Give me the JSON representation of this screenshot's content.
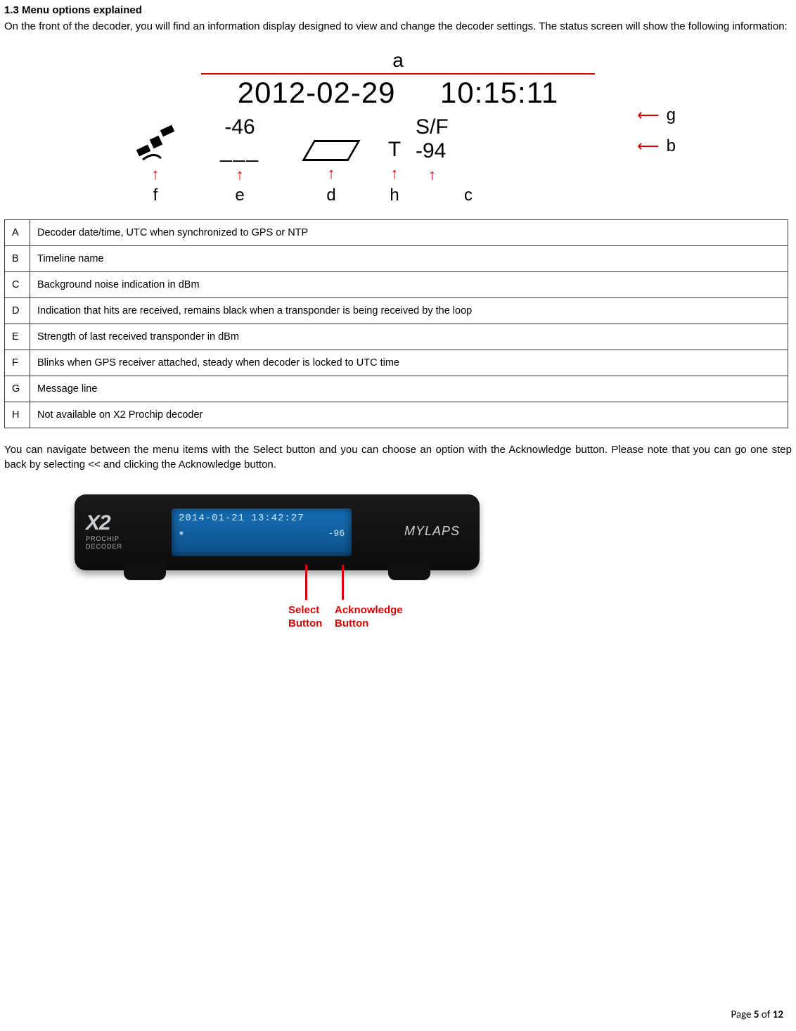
{
  "section": {
    "title": "1.3 Menu options explained",
    "intro": "On the front of the decoder, you will find an information display designed to view and change the decoder settings. The status screen will show the following information:",
    "nav_text": "You can navigate between the menu items with the Select button and you can choose an option with the Acknowledge button. Please note that you can go one step back by selecting << and clicking the Acknowledge button."
  },
  "figure1": {
    "label_a": "a",
    "date": "2012-02-29",
    "time": "10:15:11",
    "strength_e": "-46",
    "dash": "___",
    "h_letter": "T",
    "sf_label": "S/F",
    "noise_c": "-94",
    "label_g": "g",
    "label_b": "b",
    "label_f": "f",
    "label_e": "e",
    "label_d": "d",
    "label_h": "h",
    "label_c": "c"
  },
  "legend": [
    {
      "k": "A",
      "v": "Decoder date/time, UTC when synchronized to GPS or NTP"
    },
    {
      "k": "B",
      "v": "Timeline name"
    },
    {
      "k": "C",
      "v": "Background noise indication in dBm"
    },
    {
      "k": "D",
      "v": "Indication that hits are received, remains black when a transponder is being received by the loop"
    },
    {
      "k": "E",
      "v": "Strength of last received transponder in dBm"
    },
    {
      "k": "F",
      "v": "Blinks when GPS receiver attached, steady when decoder is locked to UTC time"
    },
    {
      "k": "G",
      "v": "Message line"
    },
    {
      "k": "H",
      "v": "Not available on X2 Prochip decoder"
    }
  ],
  "device": {
    "model": "X2",
    "sub1": "PROCHIP",
    "sub2": "DECODER",
    "brand": "MYLAPS",
    "screen_line1": "2014-01-21 13:42:27",
    "screen_sat": "✶",
    "screen_noise": "-96",
    "select_label_1": "Select",
    "select_label_2": "Button",
    "ack_label_1": "Acknowledge",
    "ack_label_2": "Button"
  },
  "footer": {
    "prefix": "Page ",
    "current": "5",
    "mid": " of ",
    "total": "12"
  }
}
